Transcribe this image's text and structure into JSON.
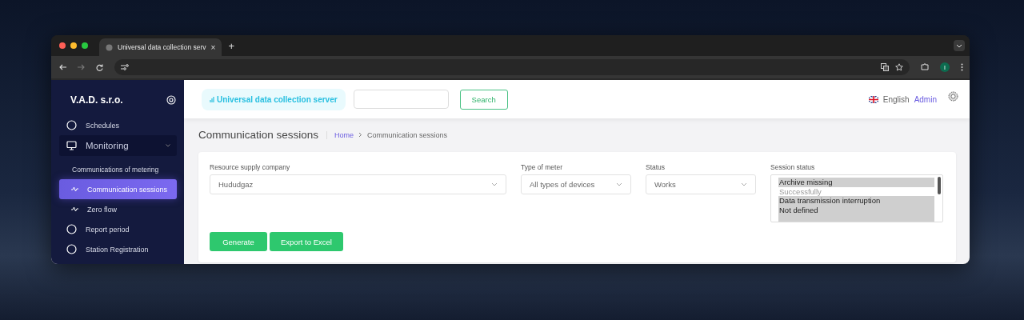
{
  "browser": {
    "tab": {
      "title": "Universal data collection serv",
      "close": "×"
    },
    "new_tab": "+",
    "profile": "I"
  },
  "sidebar": {
    "brand": "V.A.D. s.r.o.",
    "items": [
      {
        "label": "Schedules",
        "kind": "page",
        "selected": false
      },
      {
        "label": "Monitoring",
        "kind": "group",
        "selected": false,
        "expanded": true,
        "children": [
          {
            "label": "Communications of metering",
            "kind": "text",
            "selected": false
          },
          {
            "label": "Communication sessions",
            "kind": "chart",
            "selected": true
          },
          {
            "label": "Zero flow",
            "kind": "chart",
            "selected": false
          }
        ]
      },
      {
        "label": "Report period",
        "kind": "page",
        "selected": false
      },
      {
        "label": "Station Registration",
        "kind": "page",
        "selected": false
      }
    ]
  },
  "header": {
    "logo": "Universal data collection server",
    "search_button": "Search",
    "language": "English",
    "user": "Admin"
  },
  "page": {
    "title": "Communication sessions",
    "breadcrumb": [
      {
        "label": "Home",
        "kind": "link"
      },
      {
        "label": "Communication sessions",
        "kind": "current"
      }
    ]
  },
  "filters": [
    {
      "kind": "select",
      "label": "Resource supply company",
      "value": "Hududgaz"
    },
    {
      "kind": "select",
      "label": "Type of meter",
      "value": "All types of devices"
    },
    {
      "kind": "select",
      "label": "Status",
      "value": "Works"
    },
    {
      "kind": "list",
      "label": "Session status",
      "options": [
        {
          "label": "Archive missing",
          "selected": true
        },
        {
          "label": "Successfully",
          "selected": false
        },
        {
          "label": "Data transmission interruption",
          "selected": true
        },
        {
          "label": "Not defined",
          "selected": true
        }
      ]
    }
  ],
  "buttons": [
    "Generate",
    "Export to Excel"
  ]
}
